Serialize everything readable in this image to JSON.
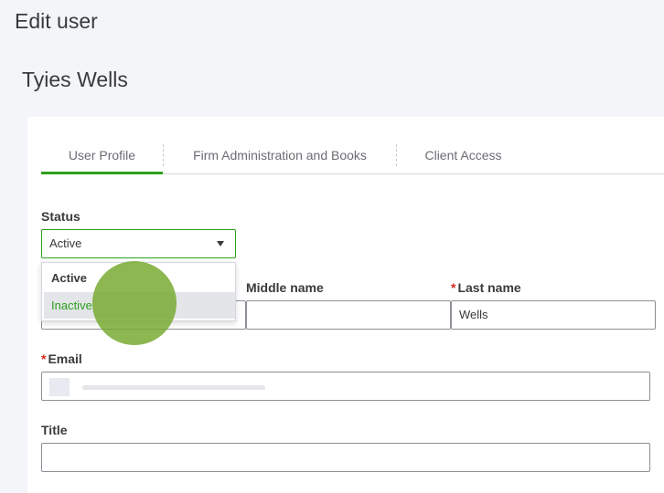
{
  "page": {
    "title": "Edit user"
  },
  "user": {
    "name": "Tyies Wells"
  },
  "tabs": [
    {
      "label": "User Profile",
      "active": true
    },
    {
      "label": "Firm Administration and Books",
      "active": false
    },
    {
      "label": "Client Access",
      "active": false
    }
  ],
  "status": {
    "label": "Status",
    "value": "Active",
    "options": [
      "Active",
      "Inactive"
    ],
    "highlighted_option": "Inactive"
  },
  "form": {
    "middle_name": {
      "label": "Middle name",
      "value": ""
    },
    "last_name": {
      "label": "Last name",
      "required_mark": "*",
      "value": "Wells"
    },
    "email": {
      "label": "Email",
      "required_mark": "*",
      "value": ""
    },
    "title": {
      "label": "Title",
      "value": ""
    }
  },
  "colors": {
    "accent": "#2ca01c",
    "required": "#d52b1e",
    "highlight_bg": "#e3e5e8"
  }
}
